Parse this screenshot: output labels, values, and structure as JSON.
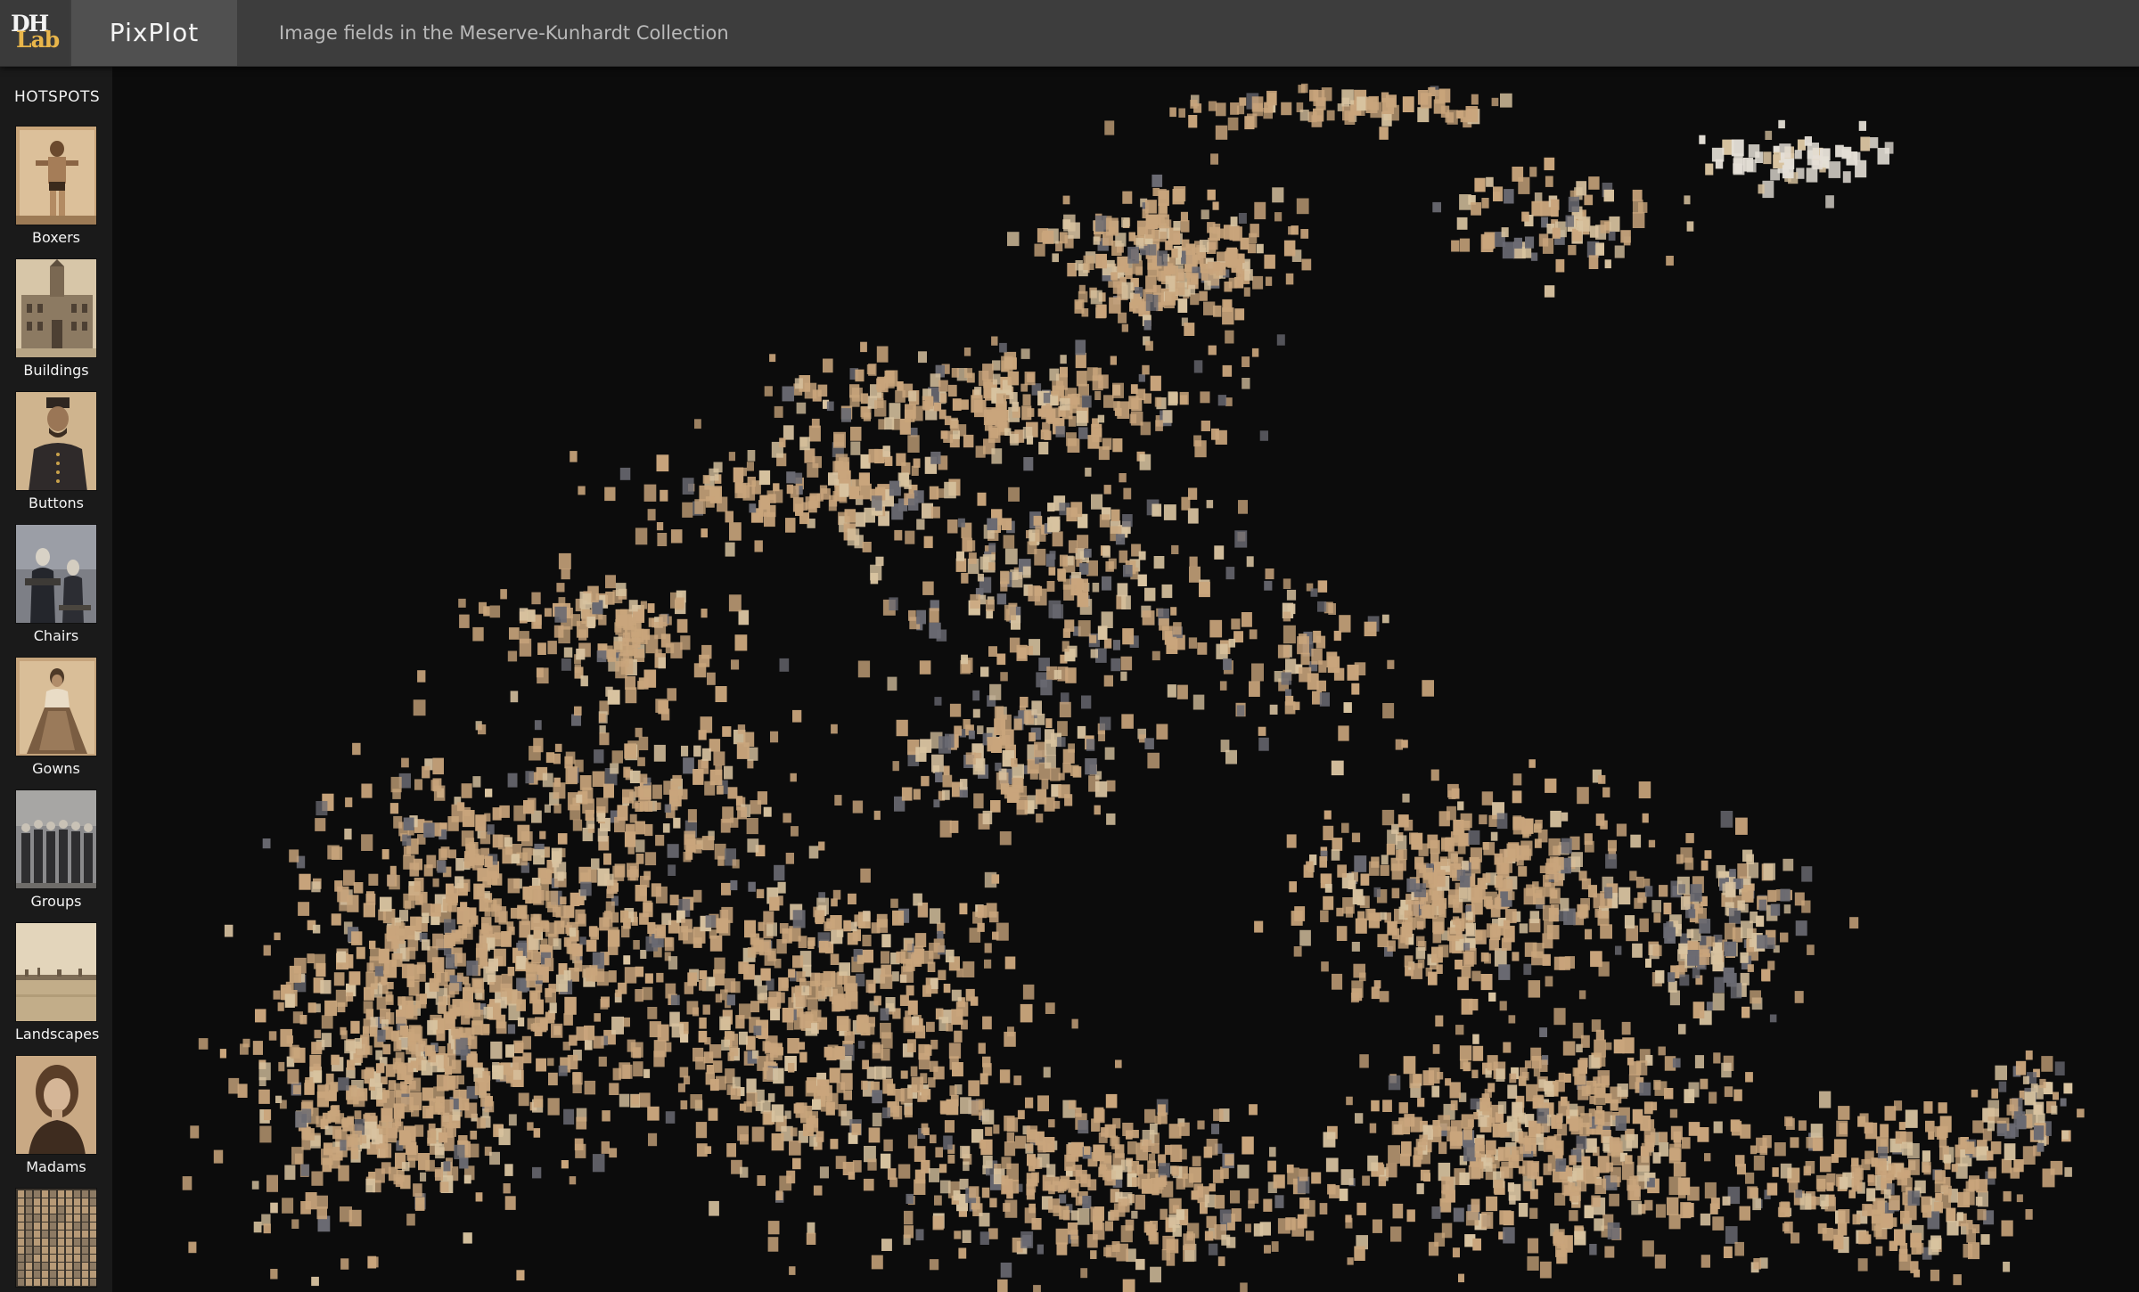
{
  "header": {
    "logo_top": "DH",
    "logo_bottom": "Lab",
    "app_title": "PixPlot",
    "subtitle": "Image fields in the Meserve-Kunhardt Collection"
  },
  "sidebar": {
    "title": "HOTSPOTS",
    "items": [
      {
        "label": "Boxers",
        "icon": "boxer-photo"
      },
      {
        "label": "Buildings",
        "icon": "building-photo"
      },
      {
        "label": "Buttons",
        "icon": "soldier-portrait-photo"
      },
      {
        "label": "Chairs",
        "icon": "seated-figures-photo"
      },
      {
        "label": "Gowns",
        "icon": "woman-in-gown-photo"
      },
      {
        "label": "Groups",
        "icon": "group-photo"
      },
      {
        "label": "Landscapes",
        "icon": "landscape-photo"
      },
      {
        "label": "Madams",
        "icon": "woman-portrait-photo"
      },
      {
        "label": "",
        "icon": "crowd-mosaic-photo"
      }
    ]
  },
  "colors": {
    "header_bg": "#3d3d3d",
    "title_bg": "#505050",
    "sidebar_bg": "#1a1a1a",
    "plot_bg": "#0c0c0c",
    "accent": "#e8b54a",
    "point_sepia": "#c9a57c",
    "point_light": "#d8c3a0",
    "point_dark": "#6a6a72"
  }
}
